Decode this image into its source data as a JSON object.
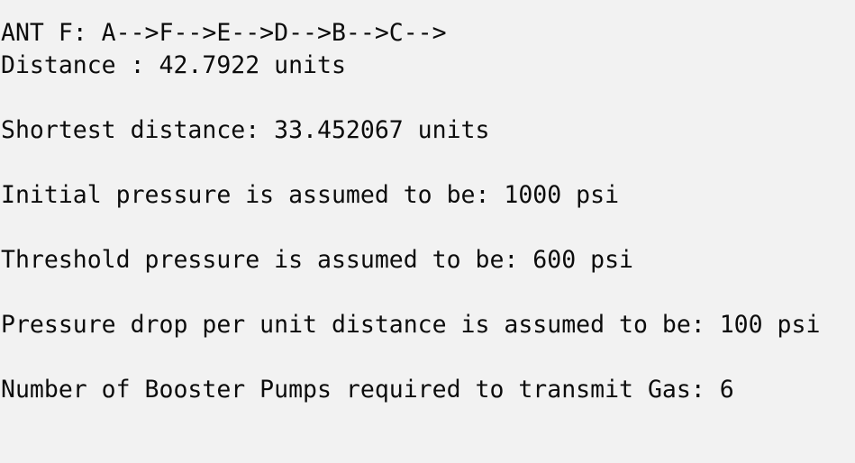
{
  "console": {
    "lines": [
      "ANT F: A-->F-->E-->D-->B-->C-->",
      "Distance : 42.7922 units",
      "",
      "Shortest distance: 33.452067 units",
      "",
      "Initial pressure is assumed to be: 1000 psi",
      "",
      "Threshold pressure is assumed to be: 600 psi",
      "",
      "Pressure drop per unit distance is assumed to be: 100 psi",
      "",
      "Number of Booster Pumps required to transmit Gas: 6"
    ]
  }
}
